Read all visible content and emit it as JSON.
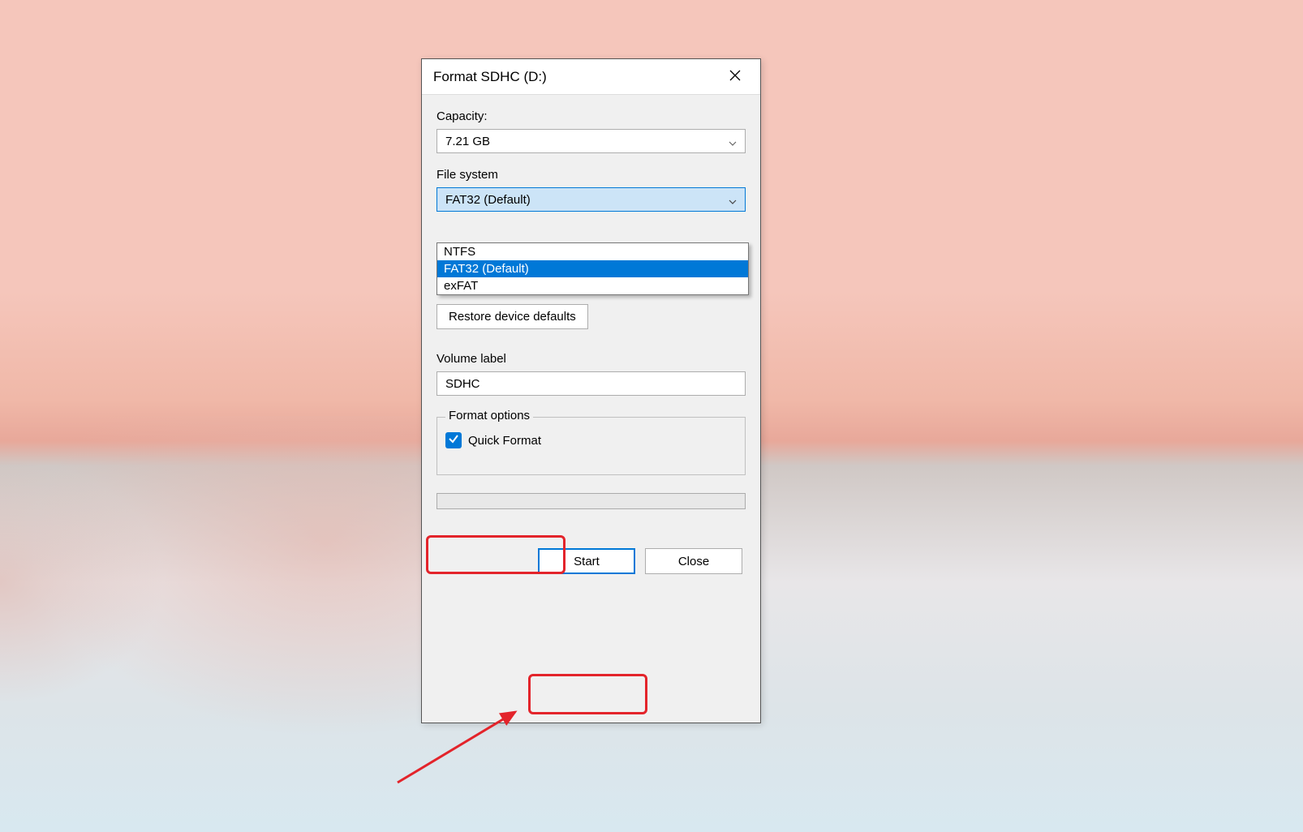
{
  "dialog": {
    "title": "Format SDHC (D:)"
  },
  "capacity": {
    "label": "Capacity:",
    "value": "7.21 GB"
  },
  "filesystem": {
    "label": "File system",
    "value": "FAT32 (Default)",
    "options": [
      "NTFS",
      "FAT32 (Default)",
      "exFAT"
    ]
  },
  "restore_button": "Restore device defaults",
  "volume": {
    "label": "Volume label",
    "value": "SDHC"
  },
  "format_options": {
    "legend": "Format options",
    "quick_format": "Quick Format"
  },
  "buttons": {
    "start": "Start",
    "close": "Close"
  }
}
